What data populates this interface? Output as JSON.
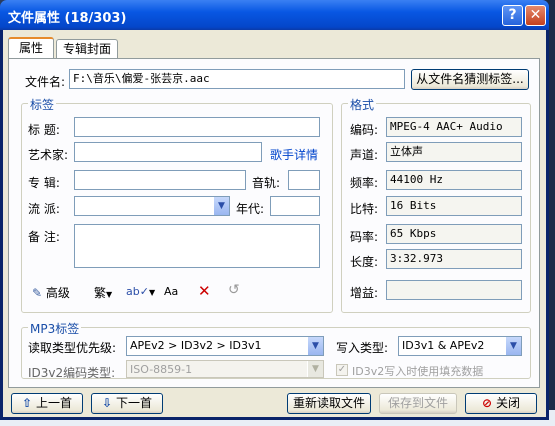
{
  "window": {
    "title": "文件属性 (18/303)"
  },
  "tabs": [
    {
      "label": "属性"
    },
    {
      "label": "专辑封面"
    }
  ],
  "file": {
    "label": "文件名:",
    "value": "F:\\音乐\\偏爱-张芸京.aac",
    "guess_button": "从文件名猜测标签..."
  },
  "tags": {
    "title": "标签",
    "title_label": "标  题:",
    "title_value": "",
    "artist_label": "艺术家:",
    "artist_value": "",
    "artist_link": "歌手详情",
    "album_label": "专  辑:",
    "album_value": "",
    "track_label": "音轨:",
    "track_value": "",
    "genre_label": "流  派:",
    "genre_value": "",
    "year_label": "年代:",
    "year_value": "",
    "comment_label": "备  注:",
    "comment_value": "",
    "toolbar": {
      "advanced": "高级",
      "traditional": "繁",
      "case": "Aa"
    }
  },
  "format": {
    "title": "格式",
    "codec_label": "编码:",
    "codec_value": "MPEG-4 AAC+ Audio",
    "channel_label": "声道:",
    "channel_value": "立体声",
    "freq_label": "频率:",
    "freq_value": "44100 Hz",
    "bits_label": "比特:",
    "bits_value": "16 Bits",
    "bitrate_label": "码率:",
    "bitrate_value": "65 Kbps",
    "length_label": "长度:",
    "length_value": "3:32.973",
    "gain_label": "增益:",
    "gain_value": ""
  },
  "mp3": {
    "title": "MP3标签",
    "read_label": "读取类型优先级:",
    "read_value": "APEv2 > ID3v2 > ID3v1",
    "write_label": "写入类型:",
    "write_value": "ID3v1 & APEv2",
    "encoding_label": "ID3v2编码类型:",
    "encoding_value": "ISO-8859-1",
    "padding_label": "ID3v2写入时使用填充数据"
  },
  "footer": {
    "prev": "上一首",
    "next": "下一首",
    "reload": "重新读取文件",
    "save": "保存到文件",
    "close": "关闭"
  },
  "colors": {
    "title_start": "#3a80f3",
    "title_end": "#0446c9",
    "accent_tab": "#e68b2c",
    "group_title": "#1a4ea8"
  }
}
